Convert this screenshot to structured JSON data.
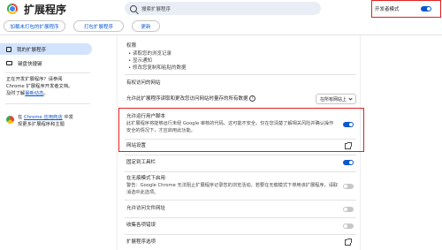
{
  "header": {
    "title": "扩展程序",
    "search_placeholder": "搜索扩展程序",
    "dev_mode_label": "开发者模式",
    "dev_mode_on": true
  },
  "toolbar": {
    "load_unpacked": "加载未打包的扩展程序",
    "pack": "打包扩展程序",
    "update": "更新"
  },
  "sidebar": {
    "items": [
      {
        "label": "我的扩展程序",
        "icon": "puzzle-icon"
      },
      {
        "label": "键盘快捷键",
        "icon": "keyboard-icon"
      }
    ],
    "info_line1": "正在开发扩展程序？请参阅",
    "info_line2": "Chrome 扩展程序开发者文档。",
    "info_line3_prefix": "及时了解",
    "info_line3_link": "最新动态",
    "info_line3_suffix": "。",
    "store_prefix": "在 ",
    "store_link": "Chrome 应用商店",
    "store_suffix": " 中发",
    "store_line2": "现更多扩展程序和主题"
  },
  "permissions": {
    "heading": "权限",
    "items": [
      "• 读取您的浏览记录",
      "• 显示通知",
      "• 修改您复制和粘贴的数据"
    ]
  },
  "site_access": {
    "heading": "有权访问的网站",
    "desc": "允许此扩展程序读取和更改您访问网站时量存的所有数据",
    "select_value": "在所有网站上"
  },
  "user_scripts": {
    "title": "允许运行用户脚本",
    "desc_line1": "此扩展程序将能够运行未经 Google 审核的代码。这可能不安全。仅在您清楚了解相关风险并确认操作",
    "desc_line2": "安全的情况下，才应启用此功能。",
    "enabled": true
  },
  "website_settings": {
    "label": "网站设置"
  },
  "pin_toolbar": {
    "label": "固定到工具栏",
    "enabled": true
  },
  "incognito": {
    "title": "在无痕模式下启用",
    "desc_line1": "警告：Google Chrome 无法阻止扩展程序记录您的浏览活动。若要在无痕模式下停用该扩展程序，请取",
    "desc_line2": "消选中此选项。",
    "enabled": false
  },
  "file_urls": {
    "label": "允许访问文件网址",
    "enabled": false
  },
  "collect_errors": {
    "label": "收集各项错误",
    "enabled": false
  },
  "ext_options": {
    "label": "扩展程序选项"
  }
}
